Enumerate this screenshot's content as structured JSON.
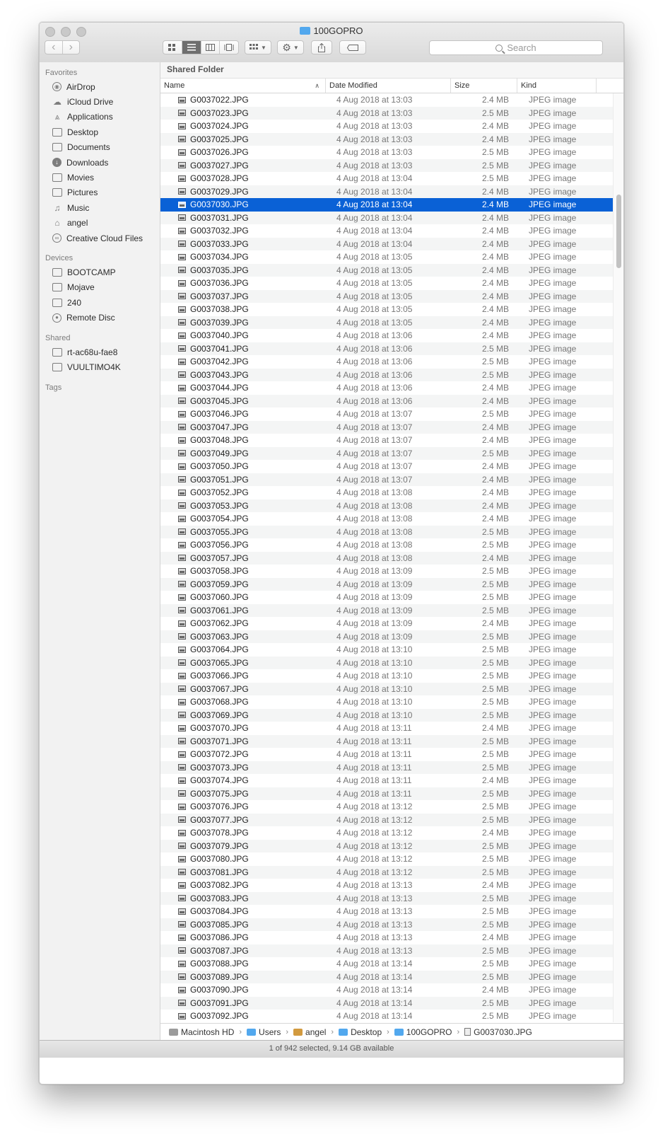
{
  "window": {
    "title": "100GOPRO"
  },
  "toolbar": {
    "back": "‹",
    "forward": "›",
    "search_placeholder": "Search"
  },
  "sidebar": {
    "favorites_heading": "Favorites",
    "favorites": [
      {
        "label": "AirDrop",
        "icon": "airdrop-icon"
      },
      {
        "label": "iCloud Drive",
        "icon": "cloud-icon"
      },
      {
        "label": "Applications",
        "icon": "applications-icon"
      },
      {
        "label": "Desktop",
        "icon": "desktop-icon"
      },
      {
        "label": "Documents",
        "icon": "documents-icon"
      },
      {
        "label": "Downloads",
        "icon": "downloads-icon"
      },
      {
        "label": "Movies",
        "icon": "film-icon"
      },
      {
        "label": "Pictures",
        "icon": "camera-icon"
      },
      {
        "label": "Music",
        "icon": "music-note-icon"
      },
      {
        "label": "angel",
        "icon": "home-icon"
      },
      {
        "label": "Creative Cloud Files",
        "icon": "creative-cloud-icon"
      }
    ],
    "devices_heading": "Devices",
    "devices": [
      {
        "label": "BOOTCAMP",
        "icon": "disk-icon"
      },
      {
        "label": "Mojave",
        "icon": "disk-icon"
      },
      {
        "label": "240",
        "icon": "disk-icon"
      },
      {
        "label": "Remote Disc",
        "icon": "disc-icon"
      }
    ],
    "shared_heading": "Shared",
    "shared": [
      {
        "label": "rt-ac68u-fae8",
        "icon": "computer-icon"
      },
      {
        "label": "VUULTIMO4K",
        "icon": "display-icon"
      }
    ],
    "tags_heading": "Tags"
  },
  "content": {
    "banner": "Shared Folder",
    "columns": {
      "name": "Name",
      "date": "Date Modified",
      "size": "Size",
      "kind": "Kind"
    },
    "files": [
      {
        "name": "G0037022.JPG",
        "date": "4 Aug 2018 at 13:03",
        "size": "2.4 MB",
        "kind": "JPEG image"
      },
      {
        "name": "G0037023.JPG",
        "date": "4 Aug 2018 at 13:03",
        "size": "2.5 MB",
        "kind": "JPEG image"
      },
      {
        "name": "G0037024.JPG",
        "date": "4 Aug 2018 at 13:03",
        "size": "2.4 MB",
        "kind": "JPEG image"
      },
      {
        "name": "G0037025.JPG",
        "date": "4 Aug 2018 at 13:03",
        "size": "2.4 MB",
        "kind": "JPEG image"
      },
      {
        "name": "G0037026.JPG",
        "date": "4 Aug 2018 at 13:03",
        "size": "2.5 MB",
        "kind": "JPEG image"
      },
      {
        "name": "G0037027.JPG",
        "date": "4 Aug 2018 at 13:03",
        "size": "2.5 MB",
        "kind": "JPEG image"
      },
      {
        "name": "G0037028.JPG",
        "date": "4 Aug 2018 at 13:04",
        "size": "2.5 MB",
        "kind": "JPEG image"
      },
      {
        "name": "G0037029.JPG",
        "date": "4 Aug 2018 at 13:04",
        "size": "2.4 MB",
        "kind": "JPEG image"
      },
      {
        "name": "G0037030.JPG",
        "date": "4 Aug 2018 at 13:04",
        "size": "2.4 MB",
        "kind": "JPEG image",
        "selected": true
      },
      {
        "name": "G0037031.JPG",
        "date": "4 Aug 2018 at 13:04",
        "size": "2.4 MB",
        "kind": "JPEG image"
      },
      {
        "name": "G0037032.JPG",
        "date": "4 Aug 2018 at 13:04",
        "size": "2.4 MB",
        "kind": "JPEG image"
      },
      {
        "name": "G0037033.JPG",
        "date": "4 Aug 2018 at 13:04",
        "size": "2.4 MB",
        "kind": "JPEG image"
      },
      {
        "name": "G0037034.JPG",
        "date": "4 Aug 2018 at 13:05",
        "size": "2.4 MB",
        "kind": "JPEG image"
      },
      {
        "name": "G0037035.JPG",
        "date": "4 Aug 2018 at 13:05",
        "size": "2.4 MB",
        "kind": "JPEG image"
      },
      {
        "name": "G0037036.JPG",
        "date": "4 Aug 2018 at 13:05",
        "size": "2.4 MB",
        "kind": "JPEG image"
      },
      {
        "name": "G0037037.JPG",
        "date": "4 Aug 2018 at 13:05",
        "size": "2.4 MB",
        "kind": "JPEG image"
      },
      {
        "name": "G0037038.JPG",
        "date": "4 Aug 2018 at 13:05",
        "size": "2.4 MB",
        "kind": "JPEG image"
      },
      {
        "name": "G0037039.JPG",
        "date": "4 Aug 2018 at 13:05",
        "size": "2.4 MB",
        "kind": "JPEG image"
      },
      {
        "name": "G0037040.JPG",
        "date": "4 Aug 2018 at 13:06",
        "size": "2.4 MB",
        "kind": "JPEG image"
      },
      {
        "name": "G0037041.JPG",
        "date": "4 Aug 2018 at 13:06",
        "size": "2.5 MB",
        "kind": "JPEG image"
      },
      {
        "name": "G0037042.JPG",
        "date": "4 Aug 2018 at 13:06",
        "size": "2.5 MB",
        "kind": "JPEG image"
      },
      {
        "name": "G0037043.JPG",
        "date": "4 Aug 2018 at 13:06",
        "size": "2.5 MB",
        "kind": "JPEG image"
      },
      {
        "name": "G0037044.JPG",
        "date": "4 Aug 2018 at 13:06",
        "size": "2.4 MB",
        "kind": "JPEG image"
      },
      {
        "name": "G0037045.JPG",
        "date": "4 Aug 2018 at 13:06",
        "size": "2.4 MB",
        "kind": "JPEG image"
      },
      {
        "name": "G0037046.JPG",
        "date": "4 Aug 2018 at 13:07",
        "size": "2.5 MB",
        "kind": "JPEG image"
      },
      {
        "name": "G0037047.JPG",
        "date": "4 Aug 2018 at 13:07",
        "size": "2.4 MB",
        "kind": "JPEG image"
      },
      {
        "name": "G0037048.JPG",
        "date": "4 Aug 2018 at 13:07",
        "size": "2.4 MB",
        "kind": "JPEG image"
      },
      {
        "name": "G0037049.JPG",
        "date": "4 Aug 2018 at 13:07",
        "size": "2.5 MB",
        "kind": "JPEG image"
      },
      {
        "name": "G0037050.JPG",
        "date": "4 Aug 2018 at 13:07",
        "size": "2.4 MB",
        "kind": "JPEG image"
      },
      {
        "name": "G0037051.JPG",
        "date": "4 Aug 2018 at 13:07",
        "size": "2.4 MB",
        "kind": "JPEG image"
      },
      {
        "name": "G0037052.JPG",
        "date": "4 Aug 2018 at 13:08",
        "size": "2.4 MB",
        "kind": "JPEG image"
      },
      {
        "name": "G0037053.JPG",
        "date": "4 Aug 2018 at 13:08",
        "size": "2.4 MB",
        "kind": "JPEG image"
      },
      {
        "name": "G0037054.JPG",
        "date": "4 Aug 2018 at 13:08",
        "size": "2.4 MB",
        "kind": "JPEG image"
      },
      {
        "name": "G0037055.JPG",
        "date": "4 Aug 2018 at 13:08",
        "size": "2.5 MB",
        "kind": "JPEG image"
      },
      {
        "name": "G0037056.JPG",
        "date": "4 Aug 2018 at 13:08",
        "size": "2.5 MB",
        "kind": "JPEG image"
      },
      {
        "name": "G0037057.JPG",
        "date": "4 Aug 2018 at 13:08",
        "size": "2.4 MB",
        "kind": "JPEG image"
      },
      {
        "name": "G0037058.JPG",
        "date": "4 Aug 2018 at 13:09",
        "size": "2.5 MB",
        "kind": "JPEG image"
      },
      {
        "name": "G0037059.JPG",
        "date": "4 Aug 2018 at 13:09",
        "size": "2.5 MB",
        "kind": "JPEG image"
      },
      {
        "name": "G0037060.JPG",
        "date": "4 Aug 2018 at 13:09",
        "size": "2.5 MB",
        "kind": "JPEG image"
      },
      {
        "name": "G0037061.JPG",
        "date": "4 Aug 2018 at 13:09",
        "size": "2.5 MB",
        "kind": "JPEG image"
      },
      {
        "name": "G0037062.JPG",
        "date": "4 Aug 2018 at 13:09",
        "size": "2.4 MB",
        "kind": "JPEG image"
      },
      {
        "name": "G0037063.JPG",
        "date": "4 Aug 2018 at 13:09",
        "size": "2.5 MB",
        "kind": "JPEG image"
      },
      {
        "name": "G0037064.JPG",
        "date": "4 Aug 2018 at 13:10",
        "size": "2.5 MB",
        "kind": "JPEG image"
      },
      {
        "name": "G0037065.JPG",
        "date": "4 Aug 2018 at 13:10",
        "size": "2.5 MB",
        "kind": "JPEG image"
      },
      {
        "name": "G0037066.JPG",
        "date": "4 Aug 2018 at 13:10",
        "size": "2.5 MB",
        "kind": "JPEG image"
      },
      {
        "name": "G0037067.JPG",
        "date": "4 Aug 2018 at 13:10",
        "size": "2.5 MB",
        "kind": "JPEG image"
      },
      {
        "name": "G0037068.JPG",
        "date": "4 Aug 2018 at 13:10",
        "size": "2.5 MB",
        "kind": "JPEG image"
      },
      {
        "name": "G0037069.JPG",
        "date": "4 Aug 2018 at 13:10",
        "size": "2.5 MB",
        "kind": "JPEG image"
      },
      {
        "name": "G0037070.JPG",
        "date": "4 Aug 2018 at 13:11",
        "size": "2.4 MB",
        "kind": "JPEG image"
      },
      {
        "name": "G0037071.JPG",
        "date": "4 Aug 2018 at 13:11",
        "size": "2.5 MB",
        "kind": "JPEG image"
      },
      {
        "name": "G0037072.JPG",
        "date": "4 Aug 2018 at 13:11",
        "size": "2.5 MB",
        "kind": "JPEG image"
      },
      {
        "name": "G0037073.JPG",
        "date": "4 Aug 2018 at 13:11",
        "size": "2.5 MB",
        "kind": "JPEG image"
      },
      {
        "name": "G0037074.JPG",
        "date": "4 Aug 2018 at 13:11",
        "size": "2.4 MB",
        "kind": "JPEG image"
      },
      {
        "name": "G0037075.JPG",
        "date": "4 Aug 2018 at 13:11",
        "size": "2.5 MB",
        "kind": "JPEG image"
      },
      {
        "name": "G0037076.JPG",
        "date": "4 Aug 2018 at 13:12",
        "size": "2.5 MB",
        "kind": "JPEG image"
      },
      {
        "name": "G0037077.JPG",
        "date": "4 Aug 2018 at 13:12",
        "size": "2.5 MB",
        "kind": "JPEG image"
      },
      {
        "name": "G0037078.JPG",
        "date": "4 Aug 2018 at 13:12",
        "size": "2.4 MB",
        "kind": "JPEG image"
      },
      {
        "name": "G0037079.JPG",
        "date": "4 Aug 2018 at 13:12",
        "size": "2.5 MB",
        "kind": "JPEG image"
      },
      {
        "name": "G0037080.JPG",
        "date": "4 Aug 2018 at 13:12",
        "size": "2.5 MB",
        "kind": "JPEG image"
      },
      {
        "name": "G0037081.JPG",
        "date": "4 Aug 2018 at 13:12",
        "size": "2.5 MB",
        "kind": "JPEG image"
      },
      {
        "name": "G0037082.JPG",
        "date": "4 Aug 2018 at 13:13",
        "size": "2.4 MB",
        "kind": "JPEG image"
      },
      {
        "name": "G0037083.JPG",
        "date": "4 Aug 2018 at 13:13",
        "size": "2.5 MB",
        "kind": "JPEG image"
      },
      {
        "name": "G0037084.JPG",
        "date": "4 Aug 2018 at 13:13",
        "size": "2.5 MB",
        "kind": "JPEG image"
      },
      {
        "name": "G0037085.JPG",
        "date": "4 Aug 2018 at 13:13",
        "size": "2.5 MB",
        "kind": "JPEG image"
      },
      {
        "name": "G0037086.JPG",
        "date": "4 Aug 2018 at 13:13",
        "size": "2.4 MB",
        "kind": "JPEG image"
      },
      {
        "name": "G0037087.JPG",
        "date": "4 Aug 2018 at 13:13",
        "size": "2.5 MB",
        "kind": "JPEG image"
      },
      {
        "name": "G0037088.JPG",
        "date": "4 Aug 2018 at 13:14",
        "size": "2.5 MB",
        "kind": "JPEG image"
      },
      {
        "name": "G0037089.JPG",
        "date": "4 Aug 2018 at 13:14",
        "size": "2.5 MB",
        "kind": "JPEG image"
      },
      {
        "name": "G0037090.JPG",
        "date": "4 Aug 2018 at 13:14",
        "size": "2.4 MB",
        "kind": "JPEG image"
      },
      {
        "name": "G0037091.JPG",
        "date": "4 Aug 2018 at 13:14",
        "size": "2.5 MB",
        "kind": "JPEG image"
      },
      {
        "name": "G0037092.JPG",
        "date": "4 Aug 2018 at 13:14",
        "size": "2.5 MB",
        "kind": "JPEG image"
      }
    ]
  },
  "pathbar": [
    {
      "label": "Macintosh HD",
      "icon": "disk-icon"
    },
    {
      "label": "Users",
      "icon": "folder-icon"
    },
    {
      "label": "angel",
      "icon": "home-icon"
    },
    {
      "label": "Desktop",
      "icon": "folder-icon"
    },
    {
      "label": "100GOPRO",
      "icon": "folder-icon"
    },
    {
      "label": "G0037030.JPG",
      "icon": "file-icon"
    }
  ],
  "status": "1 of 942 selected, 9.14 GB available",
  "colors": {
    "selection": "#0a61d6",
    "folder": "#52a8ee"
  }
}
